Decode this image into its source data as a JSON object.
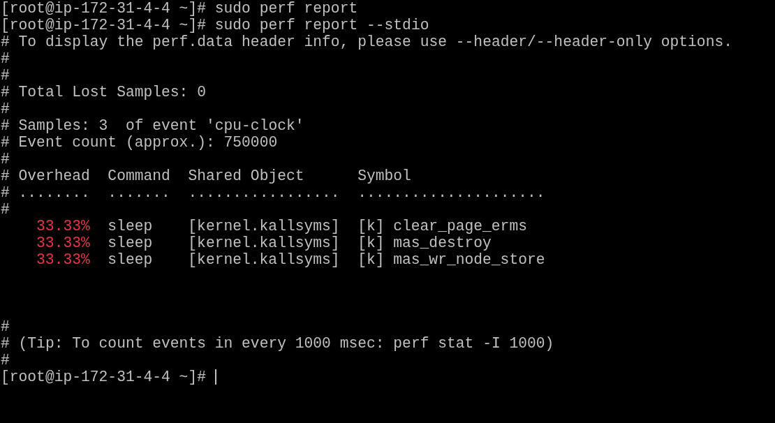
{
  "terminal": {
    "lines": [
      {
        "kind": "text",
        "text": "[root@ip-172-31-4-4 ~]# sudo perf report"
      },
      {
        "kind": "text",
        "text": "[root@ip-172-31-4-4 ~]# sudo perf report --stdio"
      },
      {
        "kind": "text",
        "text": "# To display the perf.data header info, please use --header/--header-only options."
      },
      {
        "kind": "text",
        "text": "#"
      },
      {
        "kind": "text",
        "text": "#"
      },
      {
        "kind": "text",
        "text": "# Total Lost Samples: 0"
      },
      {
        "kind": "text",
        "text": "#"
      },
      {
        "kind": "text",
        "text": "# Samples: 3  of event 'cpu-clock'"
      },
      {
        "kind": "text",
        "text": "# Event count (approx.): 750000"
      },
      {
        "kind": "text",
        "text": "#"
      },
      {
        "kind": "text",
        "text": "# Overhead  Command  Shared Object      Symbol"
      },
      {
        "kind": "text",
        "text": "# ........  .......  .................  ....................."
      },
      {
        "kind": "text",
        "text": "#"
      },
      {
        "kind": "row",
        "overhead": "33.33%",
        "command": "sleep",
        "shared_object": "[kernel.kallsyms]",
        "symbol": "[k] clear_page_erms"
      },
      {
        "kind": "row",
        "overhead": "33.33%",
        "command": "sleep",
        "shared_object": "[kernel.kallsyms]",
        "symbol": "[k] mas_destroy"
      },
      {
        "kind": "row",
        "overhead": "33.33%",
        "command": "sleep",
        "shared_object": "[kernel.kallsyms]",
        "symbol": "[k] mas_wr_node_store"
      },
      {
        "kind": "blank"
      },
      {
        "kind": "blank"
      },
      {
        "kind": "blank"
      },
      {
        "kind": "text",
        "text": "#"
      },
      {
        "kind": "text",
        "text": "# (Tip: To count events in every 1000 msec: perf stat -I 1000)"
      },
      {
        "kind": "text",
        "text": "#"
      },
      {
        "kind": "prompt",
        "text": "[root@ip-172-31-4-4 ~]#",
        "cursor": true
      }
    ]
  }
}
